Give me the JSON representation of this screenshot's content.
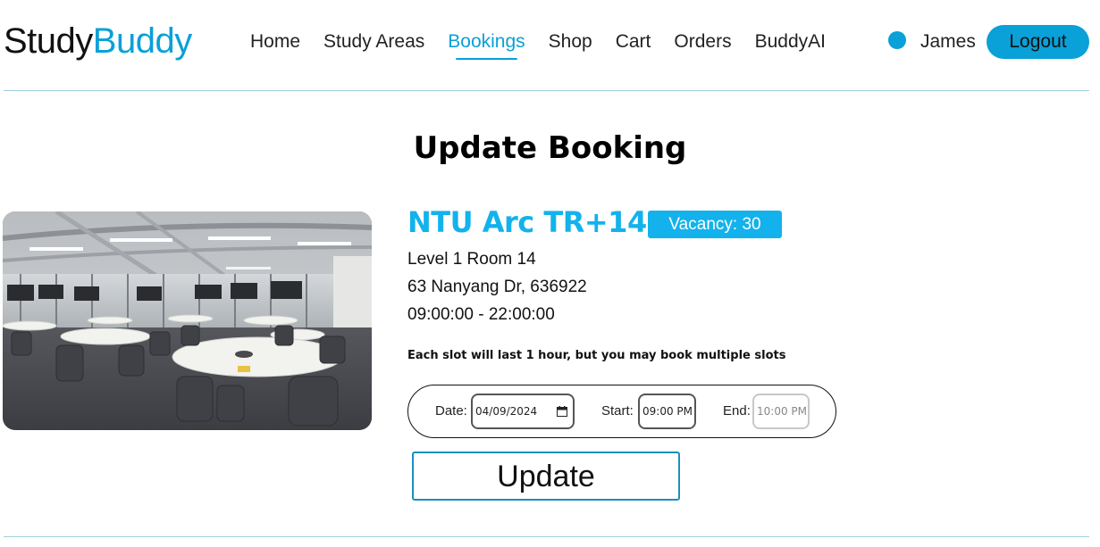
{
  "brand": {
    "part1": "Study",
    "part2": "Buddy",
    "accent": "#0aa0d8"
  },
  "nav": {
    "items": [
      {
        "label": "Home"
      },
      {
        "label": "Study Areas"
      },
      {
        "label": "Bookings",
        "active": true
      },
      {
        "label": "Shop"
      },
      {
        "label": "Cart"
      },
      {
        "label": "Orders"
      },
      {
        "label": "BuddyAI"
      }
    ]
  },
  "user": {
    "name": "James",
    "logout_label": "Logout"
  },
  "page": {
    "title": "Update Booking"
  },
  "room": {
    "image_icon": "study-room-photo",
    "name": "NTU Arc TR+14",
    "vacancy": "Vacancy: 30",
    "location": "Level 1 Room 14",
    "address": "63 Nanyang Dr, 636922",
    "hours": "09:00:00 - 22:00:00",
    "accent": "#13b2ec"
  },
  "booking": {
    "note": "Each slot will last 1 hour, but you may book multiple slots",
    "date_label": "Date:",
    "date_value": "04/09/2024",
    "start_label": "Start:",
    "start_value": "09:00 PM",
    "end_label": "End:",
    "end_value": "10:00 PM",
    "update_label": "Update"
  }
}
